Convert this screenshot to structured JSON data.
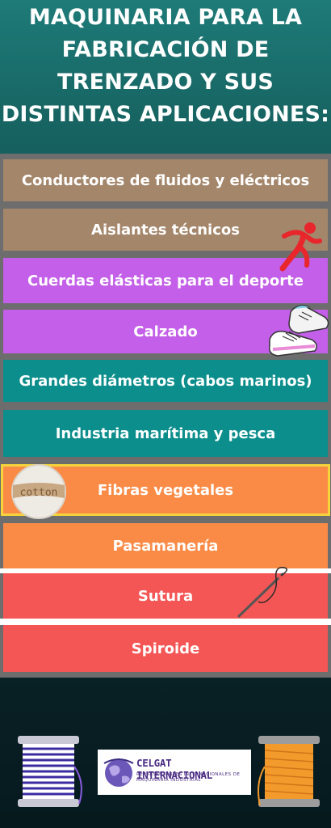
{
  "title": "MAQUINARIA PARA LA FABRICACIÓN DE TRENZADO Y SUS DISTINTAS APLICACIONES:",
  "applications": [
    "Conductores de fluidos y eléctricos",
    "Aislantes técnicos",
    "Cuerdas elásticas para el deporte",
    "Calzado",
    "Grandes diámetros (cabos marinos)",
    "Industria marítima y pesca",
    "Fibras vegetales",
    "Pasamanería",
    "Sutura",
    "Spiroide"
  ],
  "cotton_label": "cotton",
  "logo": {
    "name": "CELGAT INTERNACIONAL",
    "tagline": "REPRESENTANTES INTERNACIONALES DE MAQUINARIA INDUSTRIAL"
  },
  "colors": {
    "brown": "#a4866b",
    "purple": "#c35fe8",
    "teal": "#0b8e8c",
    "orange": "#fa8b47",
    "red": "#f45655",
    "highlight": "#f5d33c"
  },
  "icons": [
    "runner-icon",
    "sneakers-icon",
    "cotton-ball-icon",
    "needle-thread-icon",
    "spool-icon",
    "globe-icon"
  ]
}
